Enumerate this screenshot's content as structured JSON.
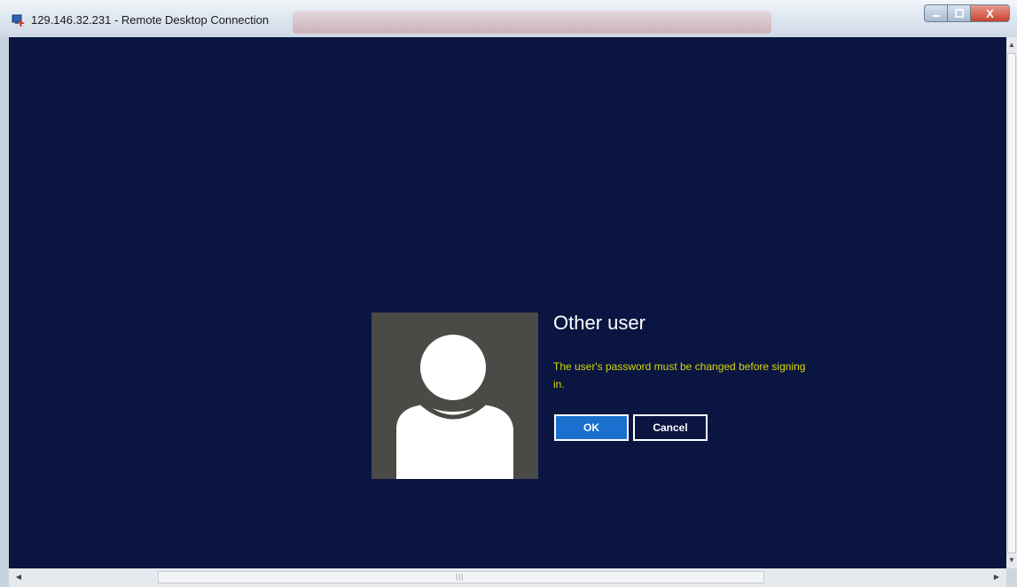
{
  "window": {
    "title": "129.146.32.231 - Remote Desktop Connection",
    "icon": "remote-desktop-icon",
    "controls": {
      "minimize": "minimize-icon",
      "maximize": "maximize-icon",
      "close_glyph": "X"
    }
  },
  "login": {
    "avatar": "user-silhouette-icon",
    "user_name": "Other user",
    "message": "The user's password must be changed before signing in.",
    "ok_label": "OK",
    "cancel_label": "Cancel"
  },
  "colors": {
    "desktop_background": "#0a1641",
    "message_text": "#d6d60a",
    "ok_button": "#1a6fcf",
    "avatar_tile": "#4a4a46"
  }
}
